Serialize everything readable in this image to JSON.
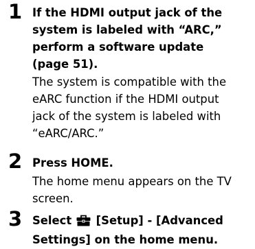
{
  "steps": [
    {
      "number": "1",
      "title_lines": [
        "If the HDMI output jack of the",
        "system is labeled with “ARC,”",
        "perform a software update",
        "(page 51)."
      ],
      "body_lines": [
        "The system is compatible with the",
        "eARC function if the HDMI output",
        "jack of the system is labeled with",
        "“eARC/ARC.”"
      ]
    },
    {
      "number": "2",
      "title_lines": [
        "Press HOME."
      ],
      "body_lines": [
        "The home menu appears on the TV",
        "screen."
      ]
    },
    {
      "number": "3",
      "title_line1_prefix": "Select",
      "title_line1_suffix": "[Setup] - [Advanced",
      "title_line2": "Settings] on the home menu.",
      "icon": "toolbox-icon"
    }
  ]
}
